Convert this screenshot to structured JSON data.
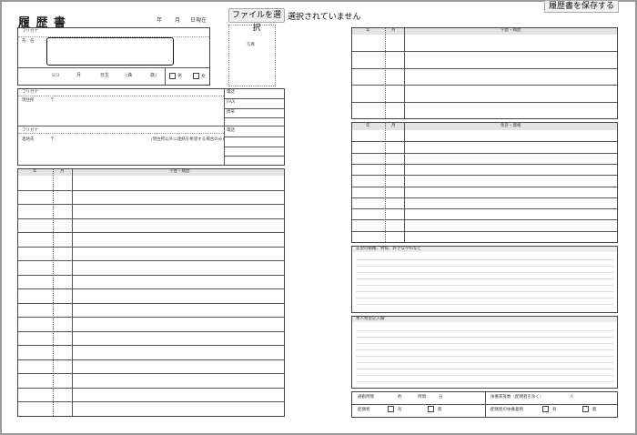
{
  "window": {
    "frame_color": "#9a9a9a"
  },
  "header": {
    "title": "履 歴 書",
    "date_year": "年",
    "date_month": "月",
    "date_suffix": "日現在"
  },
  "file_input": {
    "button_label": "ファイルを選択",
    "status": "選択されていません"
  },
  "save_button": {
    "label": "履歴書を保存する"
  },
  "photo": {
    "label": "写真"
  },
  "personal": {
    "furigana": "フリガナ",
    "name_label": "氏　名",
    "name_value": "",
    "birth_era": "S/3",
    "birth_month": "月",
    "birth_day": "日生",
    "age_open": "(満",
    "age_close": "歳)",
    "male": "男",
    "female": "女"
  },
  "address": {
    "furigana": "フリガナ",
    "current_label": "現住所",
    "postal_mark": "〒",
    "contact_furigana": "フリガナ",
    "contact_label": "連絡先",
    "contact_postal": "〒",
    "contact_note": "(現住所以外に連絡を希望する場合のみ)",
    "phone_label": "電話",
    "fax_label": "FAX",
    "mobile_label": "携帯",
    "phone2_label": "電話"
  },
  "history_table": {
    "col_year": "年",
    "col_month": "月",
    "col_content": "学歴・職歴"
  },
  "history_table_right": {
    "col_year": "年",
    "col_month": "月",
    "col_content": "学歴・職歴"
  },
  "license_table": {
    "col_year": "年",
    "col_month": "月",
    "col_content": "免許・資格"
  },
  "motivation": {
    "label": "志望の動機、特技、好きな学科など"
  },
  "requests": {
    "label": "本人希望記入欄"
  },
  "footer": {
    "commute_label": "通勤時間",
    "commute_hours": "約",
    "commute_hour_unit": "時間",
    "commute_min_unit": "分",
    "dependents_label": "扶養家族数（配偶者を除く）",
    "dependents_unit": "人",
    "spouse_label": "配偶者",
    "spouse_yes": "有",
    "spouse_no": "無",
    "spouse_duty_label": "配偶者の扶養義務",
    "duty_yes": "有",
    "duty_no": "無"
  }
}
